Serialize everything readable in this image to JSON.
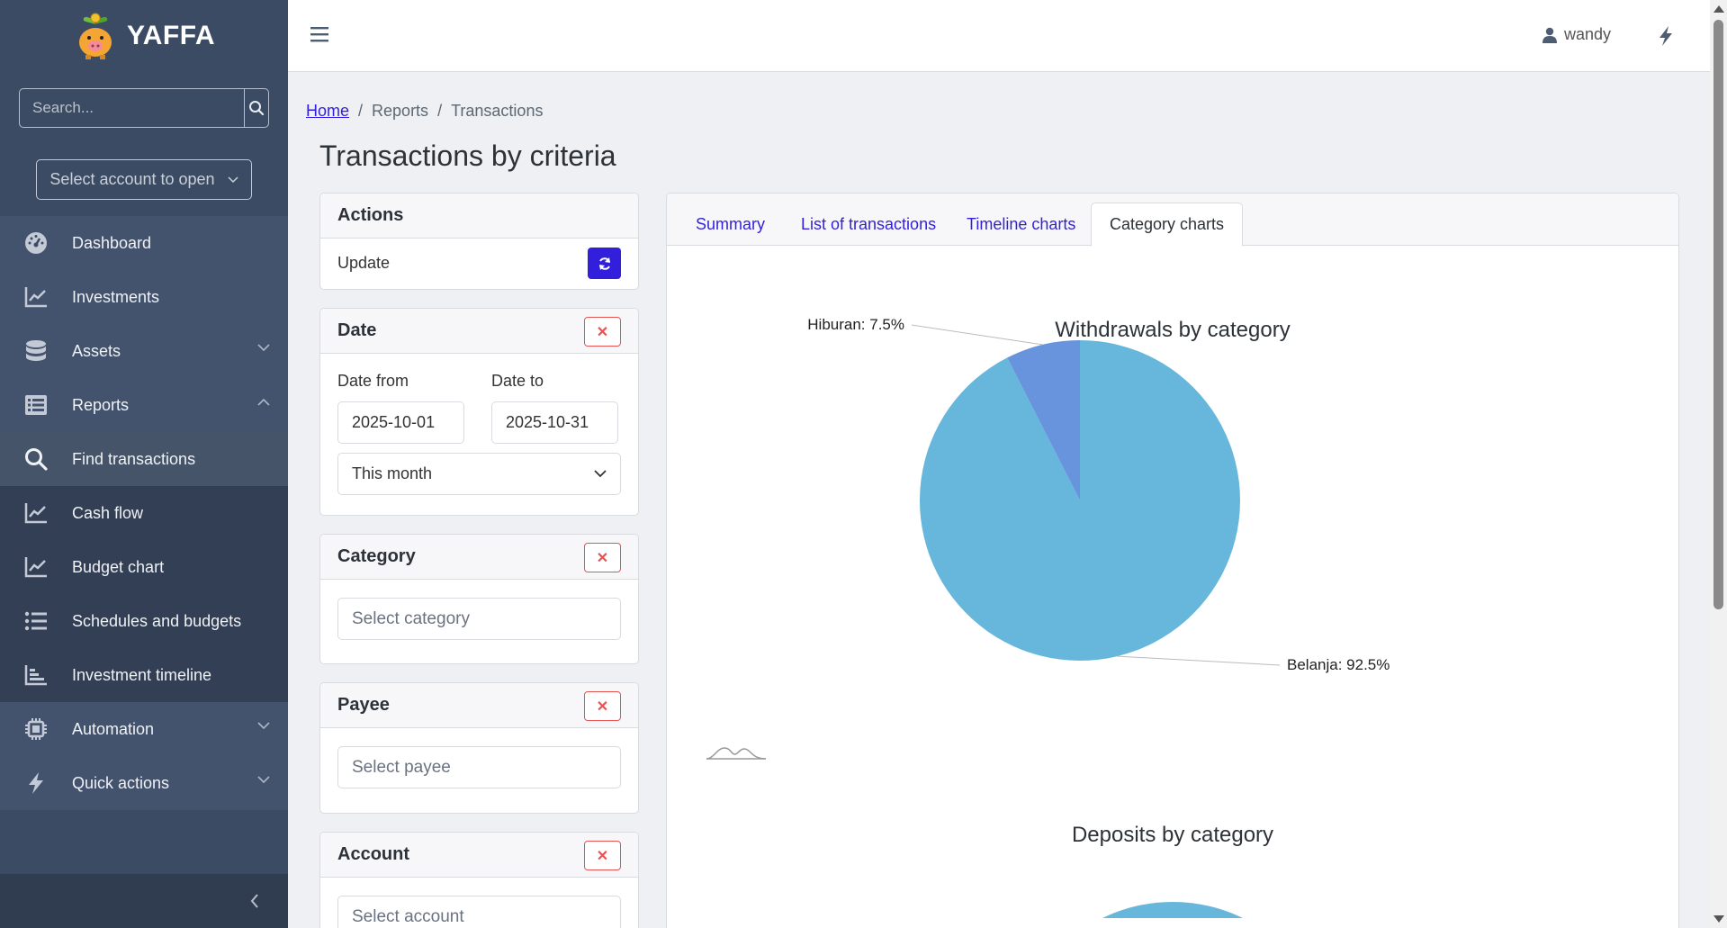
{
  "sidebar": {
    "brand_name": "YAFFA",
    "search_placeholder": "Search...",
    "account_select": "Select account to open",
    "items": [
      {
        "label": "Dashboard",
        "icon": "gauge-icon"
      },
      {
        "label": "Investments",
        "icon": "chart-line-icon"
      },
      {
        "label": "Assets",
        "icon": "database-icon"
      },
      {
        "label": "Reports",
        "icon": "table-list-icon"
      },
      {
        "label": "Find transactions",
        "icon": "search-icon"
      },
      {
        "label": "Cash flow",
        "icon": "chart-line-icon"
      },
      {
        "label": "Budget chart",
        "icon": "chart-line-icon"
      },
      {
        "label": "Schedules and budgets",
        "icon": "list-icon"
      },
      {
        "label": "Investment timeline",
        "icon": "chart-bar-icon"
      },
      {
        "label": "Automation",
        "icon": "chip-icon"
      },
      {
        "label": "Quick actions",
        "icon": "bolt-icon"
      }
    ]
  },
  "header": {
    "username": "wandy"
  },
  "breadcrumb": {
    "home": "Home",
    "reports": "Reports",
    "current": "Transactions"
  },
  "page_title": "Transactions by criteria",
  "actions": {
    "title": "Actions",
    "update_label": "Update"
  },
  "date": {
    "title": "Date",
    "from_label": "Date from",
    "to_label": "Date to",
    "from_value": "2025-10-01",
    "to_value": "2025-10-31",
    "preset": "This month"
  },
  "category": {
    "title": "Category",
    "placeholder": "Select category"
  },
  "payee": {
    "title": "Payee",
    "placeholder": "Select payee"
  },
  "account": {
    "title": "Account",
    "placeholder": "Select account"
  },
  "tabs": [
    {
      "label": "Summary"
    },
    {
      "label": "List of transactions"
    },
    {
      "label": "Timeline charts"
    },
    {
      "label": "Category charts"
    }
  ],
  "colors": {
    "primary": "#321fdb",
    "danger": "#e55353",
    "sidebar": "#3c4b64",
    "pie_main": "#67b7dc",
    "pie_second": "#6794dc"
  },
  "chart_data": [
    {
      "type": "pie",
      "title": "Withdrawals by category",
      "slices": [
        {
          "label": "Belanja",
          "value": 92.5,
          "display": "Belanja: 92.5%",
          "color": "#67b7dc"
        },
        {
          "label": "Hiburan",
          "value": 7.5,
          "display": "Hiburan: 7.5%",
          "color": "#6794dc"
        }
      ]
    },
    {
      "type": "pie",
      "title": "Deposits by category",
      "slices": []
    }
  ]
}
